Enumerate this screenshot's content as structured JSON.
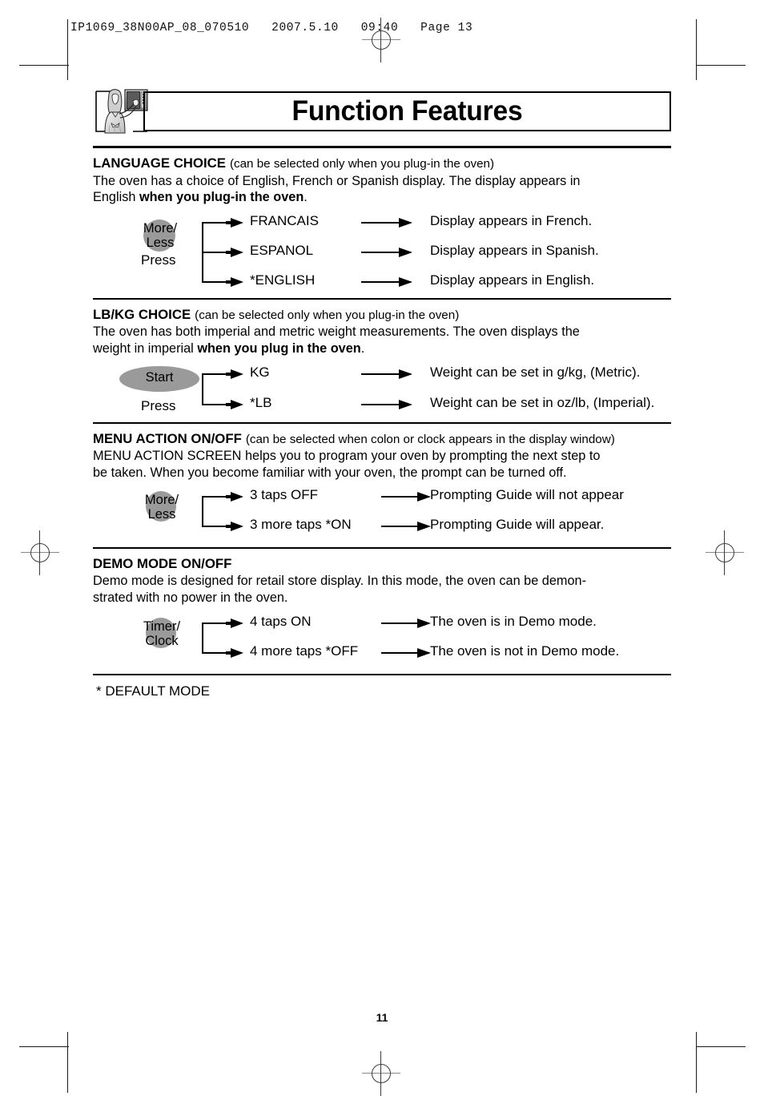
{
  "slug": "IP1069_38N00AP_08_070510   2007.5.10   09:40   Page 13",
  "title": "Function Features",
  "title_icon": "woman-operating-microwave-illustration",
  "sections": [
    {
      "id": "language-choice",
      "heading": "LANGUAGE CHOICE",
      "heading_note": "(can be selected only when you plug-in the oven)",
      "body_a": "The oven has a choice of English, French or Spanish display. The display appears in",
      "body_b_plain": "English ",
      "body_b_bold": "when you plug-in the oven",
      "body_b_tail": ".",
      "button_label_line1": "More/",
      "button_label_line2": "Less",
      "button_action": "Press",
      "rows": [
        {
          "option": "FRANCAIS",
          "result": "Display appears in French."
        },
        {
          "option": "ESPANOL",
          "result": "Display appears in Spanish."
        },
        {
          "option": "*ENGLISH",
          "result": "Display appears in English."
        }
      ]
    },
    {
      "id": "lb-kg-choice",
      "heading": "LB/KG CHOICE",
      "heading_note": "(can be selected only when you plug-in the oven)",
      "body_a": "The oven has both imperial and metric weight measurements. The oven displays the",
      "body_b_plain": "weight in imperial ",
      "body_b_bold": "when you plug in the oven",
      "body_b_tail": ".",
      "button_label_line1": "Start",
      "button_label_line2": "",
      "button_action": "Press",
      "rows": [
        {
          "option": "KG",
          "result": "Weight can be set in g/kg, (Metric)."
        },
        {
          "option": "*LB",
          "result": "Weight can be set in oz/lb, (Imperial)."
        }
      ]
    },
    {
      "id": "menu-action-on-off",
      "heading": "MENU ACTION ON/OFF",
      "heading_note": "(can be selected when colon or clock appears in the display window)",
      "body_a": "MENU ACTION SCREEN helps you to program your oven by prompting the next step to",
      "body_b_plain": "be taken. When you become familiar with your oven, the prompt can be turned off.",
      "body_b_bold": "",
      "body_b_tail": "",
      "button_label_line1": "More/",
      "button_label_line2": "Less",
      "button_action": "",
      "rows": [
        {
          "option": "3 taps OFF",
          "result": "Prompting Guide will not appear"
        },
        {
          "option": "3 more taps *ON",
          "result": "Prompting Guide will appear."
        }
      ]
    },
    {
      "id": "demo-mode-on-off",
      "heading": "DEMO MODE ON/OFF",
      "heading_note": "",
      "body_a": "Demo mode is designed for retail store display. In this mode, the oven can be demon-",
      "body_b_plain": "strated with no power in the oven.",
      "body_b_bold": "",
      "body_b_tail": "",
      "button_label_line1": "Timer/",
      "button_label_line2": "Clock",
      "button_action": "",
      "rows": [
        {
          "option": "4 taps ON",
          "result": "The oven is in Demo mode."
        },
        {
          "option": "4 more taps *OFF",
          "result": "The oven is not in Demo mode."
        }
      ]
    }
  ],
  "footnote": "* DEFAULT MODE",
  "page_number": "11",
  "colors": {
    "ink": "#000000",
    "button_blob": "#9a9a9a",
    "registration_mark": "#3a3a3a"
  }
}
